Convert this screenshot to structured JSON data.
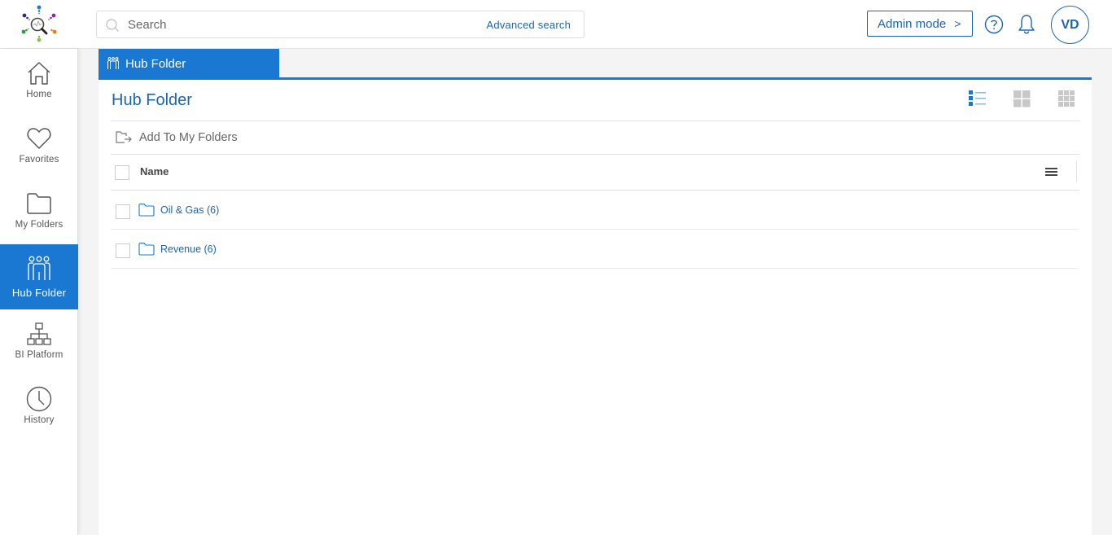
{
  "header": {
    "search_placeholder": "Search",
    "advanced_search_label": "Advanced search",
    "admin_mode_label": "Admin mode",
    "admin_mode_chevron": ">",
    "user_initials": "VD"
  },
  "sidebar": {
    "items": [
      {
        "label": "Home",
        "icon": "home-icon",
        "active": false
      },
      {
        "label": "Favorites",
        "icon": "heart-icon",
        "active": false
      },
      {
        "label": "My Folders",
        "icon": "folder-icon",
        "active": false
      },
      {
        "label": "Hub Folder",
        "icon": "people-icon",
        "active": true
      },
      {
        "label": "BI Platform",
        "icon": "hierarchy-icon",
        "active": false
      },
      {
        "label": "History",
        "icon": "clock-icon",
        "active": false
      }
    ]
  },
  "main": {
    "tab_label": "Hub Folder",
    "page_title": "Hub Folder",
    "add_to_folders_label": "Add To My Folders",
    "table": {
      "column_header": "Name",
      "rows": [
        {
          "name": "Oil & Gas (6)",
          "type": "folder"
        },
        {
          "name": "Revenue (6)",
          "type": "folder"
        }
      ]
    },
    "views": [
      "list-view",
      "large-grid-view",
      "small-grid-view"
    ],
    "active_view": "list-view"
  },
  "colors": {
    "accent": "#1a78d2",
    "link": "#1b66b1",
    "inactive_icon": "#c8c8c8"
  }
}
